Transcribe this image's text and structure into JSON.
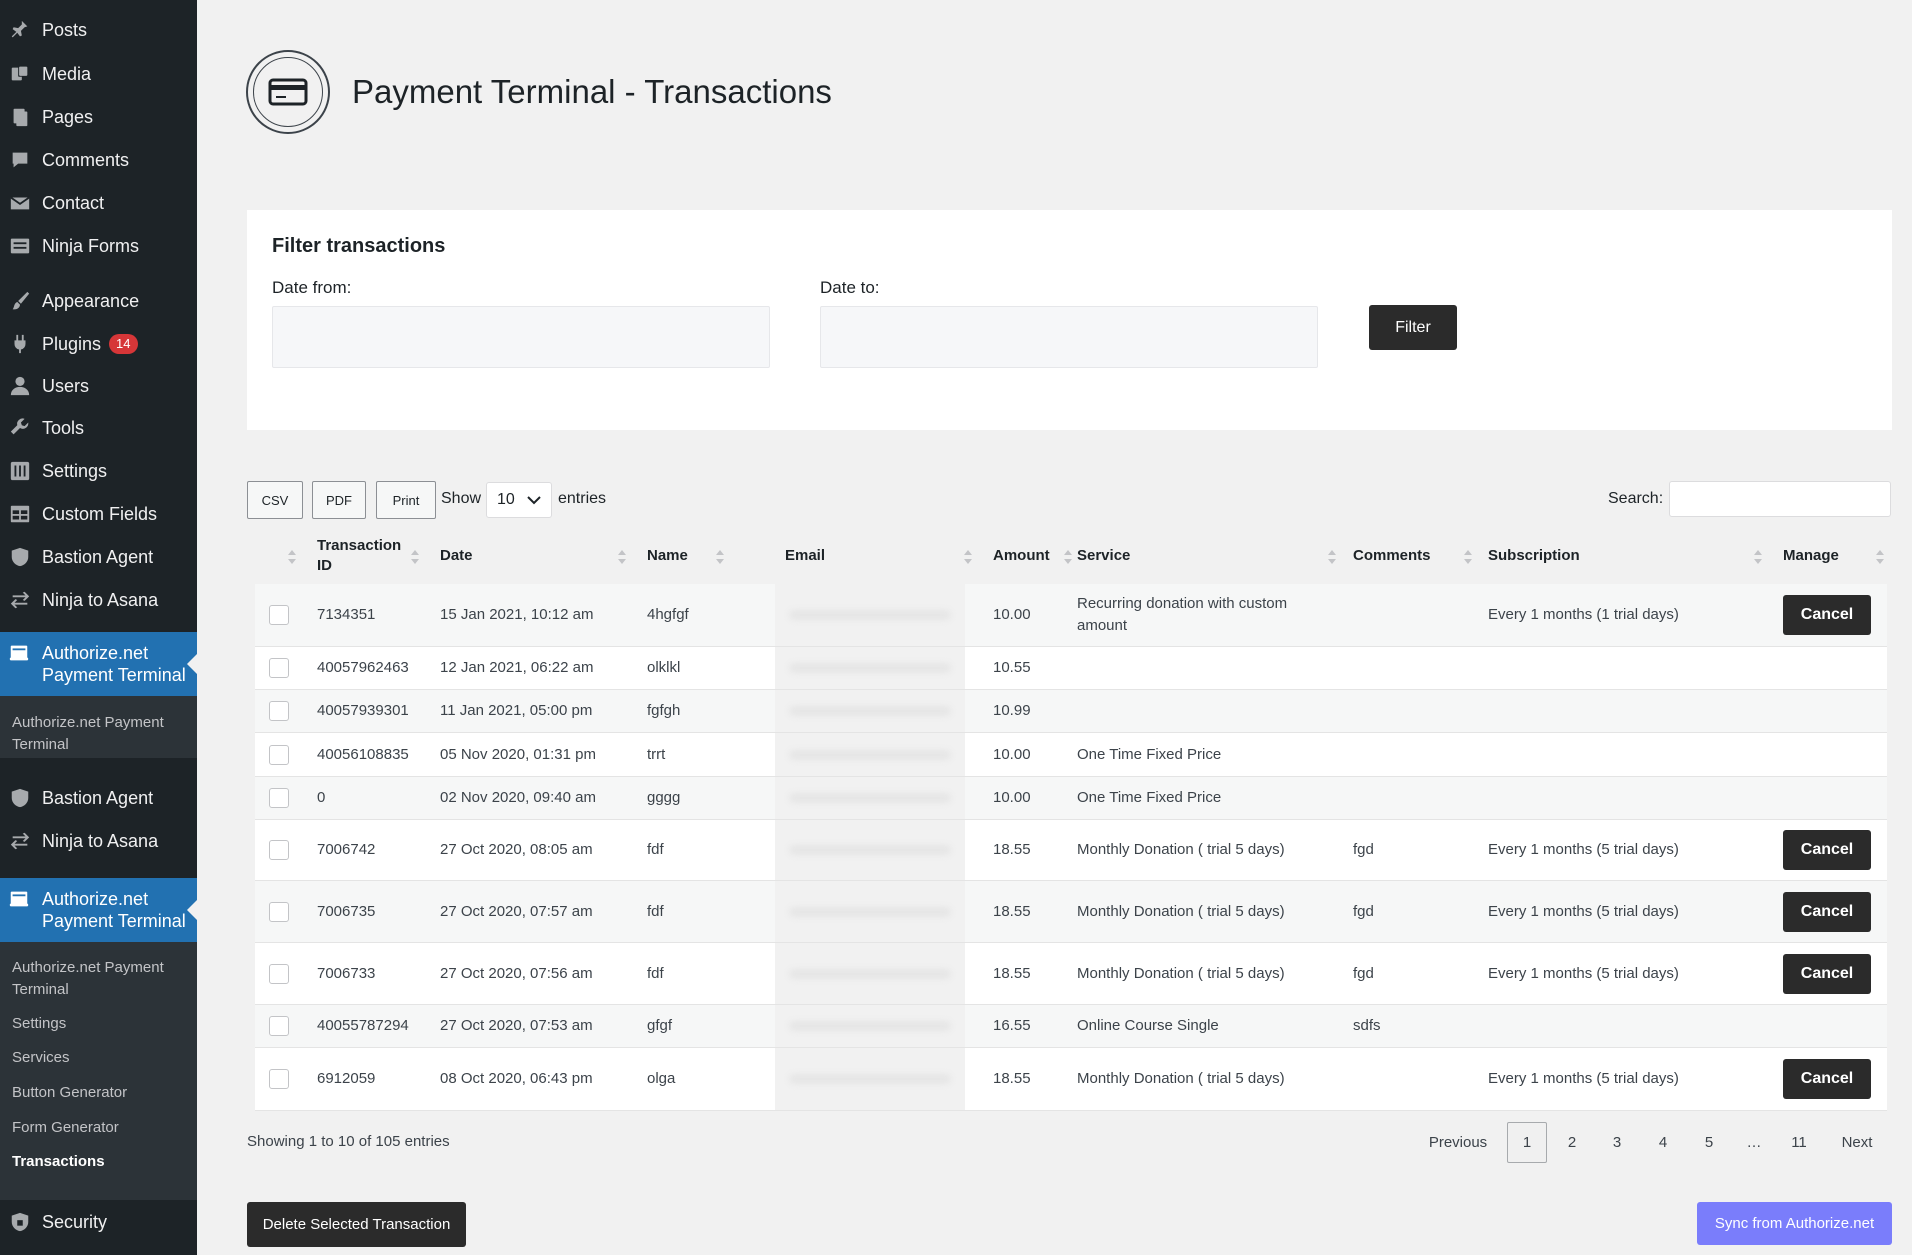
{
  "sidebar": {
    "items": [
      {
        "label": "Posts",
        "icon": "pin-icon"
      },
      {
        "label": "Media",
        "icon": "media-icon"
      },
      {
        "label": "Pages",
        "icon": "pages-icon"
      },
      {
        "label": "Comments",
        "icon": "comment-icon"
      },
      {
        "label": "Contact",
        "icon": "mail-icon"
      },
      {
        "label": "Ninja Forms",
        "icon": "forms-icon"
      },
      {
        "label": "Appearance",
        "icon": "brush-icon"
      },
      {
        "label": "Plugins",
        "icon": "plugin-icon",
        "badge": "14"
      },
      {
        "label": "Users",
        "icon": "user-icon"
      },
      {
        "label": "Tools",
        "icon": "wrench-icon"
      },
      {
        "label": "Settings",
        "icon": "settings-icon"
      },
      {
        "label": "Custom Fields",
        "icon": "table-icon"
      },
      {
        "label": "Bastion Agent",
        "icon": "shield-icon"
      },
      {
        "label": "Ninja to Asana",
        "icon": "sync-icon"
      }
    ],
    "active_label": "Authorize.net Payment Terminal",
    "flyout_label": "Authorize.net Payment Terminal",
    "partial_label": "Custom Fields",
    "repeat_items": [
      {
        "label": "Bastion Agent"
      },
      {
        "label": "Ninja to Asana"
      }
    ],
    "submenu": [
      {
        "label": "Authorize.net Payment Terminal"
      },
      {
        "label": "Settings"
      },
      {
        "label": "Services"
      },
      {
        "label": "Button Generator"
      },
      {
        "label": "Form Generator"
      },
      {
        "label": "Transactions",
        "current": true
      }
    ],
    "security_label": "Security"
  },
  "header": {
    "title": "Payment Terminal - Transactions"
  },
  "filter": {
    "heading": "Filter transactions",
    "date_from_label": "Date from:",
    "date_to_label": "Date to:",
    "button_label": "Filter"
  },
  "toolbar": {
    "csv_label": "CSV",
    "pdf_label": "PDF",
    "print_label": "Print",
    "show_label": "Show",
    "entries_value": "10",
    "entries_label": "entries",
    "search_label": "Search:"
  },
  "table": {
    "headers": {
      "transaction_id": "Transaction ID",
      "date": "Date",
      "name": "Name",
      "email": "Email",
      "amount": "Amount",
      "service": "Service",
      "comments": "Comments",
      "subscription": "Subscription",
      "manage": "Manage"
    },
    "cancel_label": "Cancel",
    "rows": [
      {
        "id": "7134351",
        "date": "15 Jan 2021, 10:12 am",
        "name": "4hgfgf",
        "amount": "10.00",
        "service": "Recurring donation with custom amount",
        "comments": "",
        "subscription": "Every 1 months (1 trial days)",
        "cancel": true
      },
      {
        "id": "40057962463",
        "date": "12 Jan 2021, 06:22 am",
        "name": "olklkl",
        "amount": "10.55",
        "service": "",
        "comments": "",
        "subscription": "",
        "cancel": false
      },
      {
        "id": "40057939301",
        "date": "11 Jan 2021, 05:00 pm",
        "name": "fgfgh",
        "amount": "10.99",
        "service": "",
        "comments": "",
        "subscription": "",
        "cancel": false
      },
      {
        "id": "40056108835",
        "date": "05 Nov 2020, 01:31 pm",
        "name": "trrt",
        "amount": "10.00",
        "service": "One Time Fixed Price",
        "comments": "",
        "subscription": "",
        "cancel": false
      },
      {
        "id": "0",
        "date": "02 Nov 2020, 09:40 am",
        "name": "gggg",
        "amount": "10.00",
        "service": "One Time Fixed Price",
        "comments": "",
        "subscription": "",
        "cancel": false
      },
      {
        "id": "7006742",
        "date": "27 Oct 2020, 08:05 am",
        "name": "fdf",
        "amount": "18.55",
        "service": "Monthly Donation ( trial 5 days)",
        "comments": "fgd",
        "subscription": "Every 1 months (5 trial days)",
        "cancel": true
      },
      {
        "id": "7006735",
        "date": "27 Oct 2020, 07:57 am",
        "name": "fdf",
        "amount": "18.55",
        "service": "Monthly Donation ( trial 5 days)",
        "comments": "fgd",
        "subscription": "Every 1 months (5 trial days)",
        "cancel": true
      },
      {
        "id": "7006733",
        "date": "27 Oct 2020, 07:56 am",
        "name": "fdf",
        "amount": "18.55",
        "service": "Monthly Donation ( trial 5 days)",
        "comments": "fgd",
        "subscription": "Every 1 months (5 trial days)",
        "cancel": true
      },
      {
        "id": "40055787294",
        "date": "27 Oct 2020, 07:53 am",
        "name": "gfgf",
        "amount": "16.55",
        "service": "Online Course Single",
        "comments": "sdfs",
        "subscription": "",
        "cancel": false
      },
      {
        "id": "6912059",
        "date": "08 Oct 2020, 06:43 pm",
        "name": "olga",
        "amount": "18.55",
        "service": "Monthly Donation ( trial 5 days)",
        "comments": "",
        "subscription": "Every 1 months (5 trial days)",
        "cancel": true
      }
    ]
  },
  "footer": {
    "showing_text": "Showing 1 to 10 of 105 entries",
    "pagination": {
      "previous": "Previous",
      "pages": [
        "1",
        "2",
        "3",
        "4",
        "5",
        "…",
        "11"
      ],
      "next": "Next",
      "current": "1"
    },
    "delete_label": "Delete Selected Transaction",
    "sync_label": "Sync from Authorize.net"
  },
  "colors": {
    "sidebar_bg": "#1d2327",
    "active_menu": "#2271b1",
    "dark_button": "#2b2b2b",
    "sync_button": "#7a7dfb",
    "badge": "#d63638"
  }
}
